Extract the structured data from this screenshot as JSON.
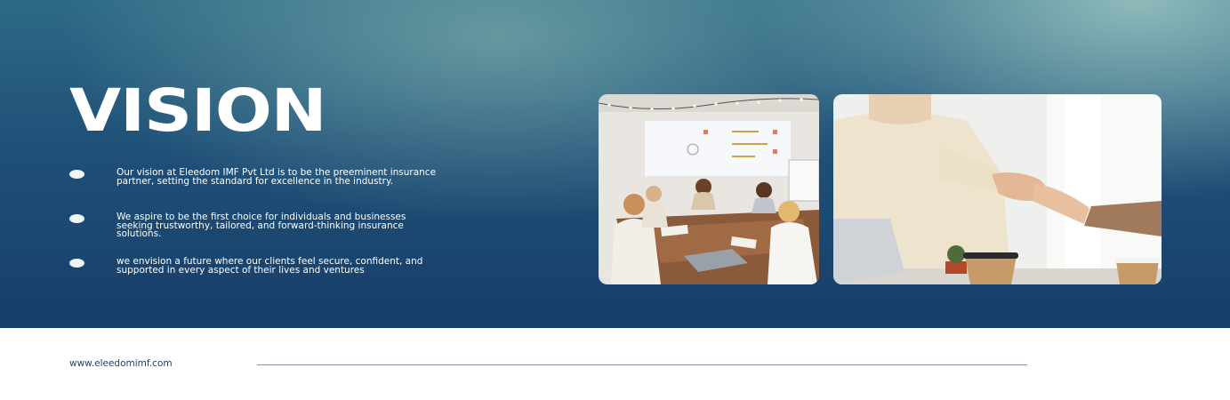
{
  "hero": {
    "title": "VISION",
    "bullets": [
      {
        "text": "Our vision at Eleedom IMF Pvt Ltd is to be the preeminent insurance partner, setting the standard for excellence in the industry."
      },
      {
        "text": "We aspire to be the first choice for individuals and businesses seeking trustworthy, tailored, and forward-thinking insurance solutions."
      },
      {
        "text": "we envision a future where our clients feel secure, confident, and supported in every aspect of their lives and ventures"
      }
    ],
    "photos": [
      {
        "name": "meeting-room-photo"
      },
      {
        "name": "handshake-photo"
      }
    ]
  },
  "footer": {
    "url": "www.eleedomimf.com"
  },
  "colors": {
    "hero_top": "#2d6a86",
    "hero_bottom": "#173e68",
    "title": "#ffffff",
    "footer_text": "#1e3f66"
  }
}
